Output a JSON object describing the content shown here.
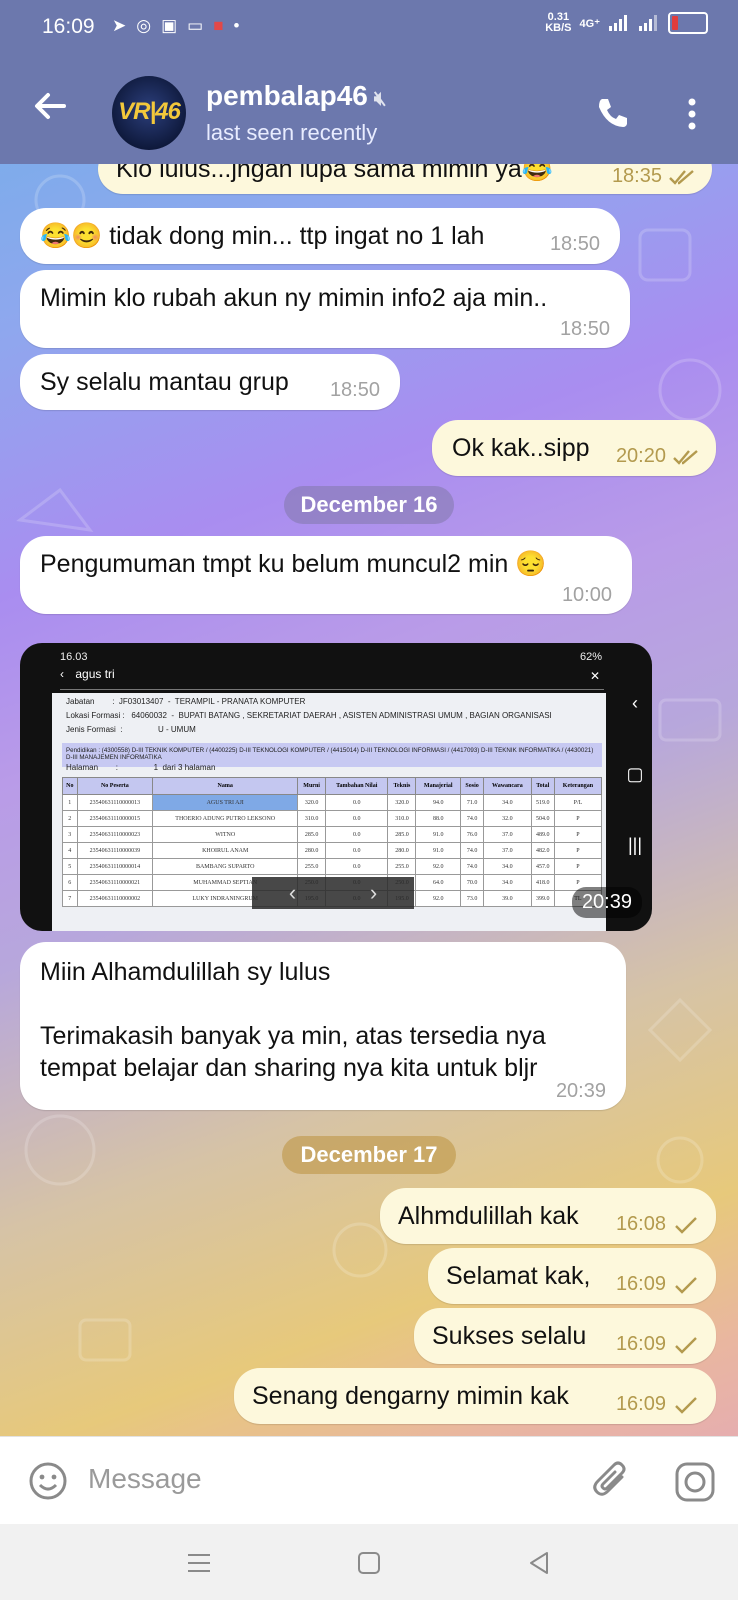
{
  "status_bar": {
    "time": "16:09",
    "speed_value": "0.31",
    "speed_unit": "KB/S",
    "network": "4G⁺"
  },
  "header": {
    "contact_name": "pembalap46",
    "avatar_text": "VR|46",
    "last_seen": "last seen recently"
  },
  "messages": [
    {
      "dir": "out",
      "text": "Klo lulus...jngan lupa sama mimin ya😂",
      "time": "18:35",
      "status": "read"
    },
    {
      "dir": "in",
      "text": "😂😊 tidak dong min... ttp ingat no 1 lah",
      "time": "18:50"
    },
    {
      "dir": "in",
      "text": "Mimin klo rubah akun ny mimin info2 aja min..",
      "time": "18:50"
    },
    {
      "dir": "in",
      "text": "Sy selalu mantau grup",
      "time": "18:50"
    },
    {
      "dir": "out",
      "text": "Ok kak..sipp",
      "time": "20:20",
      "status": "read"
    },
    {
      "dir": "in",
      "text": "Pengumuman tmpt ku belum muncul2 min 😔",
      "time": "10:00"
    },
    {
      "dir": "in",
      "text": "Miin Alhamdulillah sy lulus\n\nTerimakasih banyak ya min, atas tersedia nya\ntempat belajar dan sharing nya kita untuk bljr",
      "time": "20:39"
    },
    {
      "dir": "out",
      "text": "Alhmdulillah kak",
      "time": "16:08",
      "status": "sent"
    },
    {
      "dir": "out",
      "text": "Selamat kak,",
      "time": "16:09",
      "status": "sent"
    },
    {
      "dir": "out",
      "text": "Sukses selalu",
      "time": "16:09",
      "status": "sent"
    },
    {
      "dir": "out",
      "text": "Senang dengarny mimin kak",
      "time": "16:09",
      "status": "sent"
    }
  ],
  "date_separators": [
    "December 16",
    "December 17"
  ],
  "image_message": {
    "time": "20:39",
    "shot_time": "16.03",
    "shot_battery": "62%",
    "search_query": "agus tri",
    "jabatan": "Jabatan        :  JF03013407  -  TERAMPIL - PRANATA KOMPUTER",
    "lokasi": "Lokasi Formasi :   64060032  -  BUPATI BATANG , SEKRETARIAT DAERAH , ASISTEN ADMINISTRASI UMUM , BAGIAN ORGANISASI",
    "jenis": "Jenis Formasi  :                U - UMUM",
    "pendidikan": "Pendidikan     :  (4300558) D-III TEKNIK KOMPUTER / (4400225) D-III TEKNOLOGI KOMPUTER / (4415014) D-III TEKNOLOGI INFORMASI / (4417093) D-III TEKNIK INFORMATIKA / (4430021) D-III MANAJEMEN INFORMATIKA",
    "halaman": "Halaman        :                1  dari 3 halaman",
    "columns": [
      "No",
      "No Peserta",
      "Nama",
      "Murni",
      "Tambahan Nilai",
      "Teknis",
      "Manajerial",
      "Sosio",
      "Wawancara",
      "Total",
      "Keterangan"
    ],
    "rows": [
      [
        "1",
        "23540631110000013",
        "AGUS TRI AJI",
        "320.0",
        "0.0",
        "320.0",
        "94.0",
        "71.0",
        "34.0",
        "519.0",
        "P/L"
      ],
      [
        "2",
        "23540631110000015",
        "THOERIO ADUNG PUTRO LEKSONO",
        "310.0",
        "0.0",
        "310.0",
        "88.0",
        "74.0",
        "32.0",
        "504.0",
        "P"
      ],
      [
        "3",
        "23540631110000023",
        "WITNO",
        "285.0",
        "0.0",
        "285.0",
        "91.0",
        "76.0",
        "37.0",
        "489.0",
        "P"
      ],
      [
        "4",
        "23540631110000039",
        "KHOIRUL ANAM",
        "280.0",
        "0.0",
        "280.0",
        "91.0",
        "74.0",
        "37.0",
        "482.0",
        "P"
      ],
      [
        "5",
        "23540631110000014",
        "BAMBANG SUPARTO",
        "255.0",
        "0.0",
        "255.0",
        "92.0",
        "74.0",
        "34.0",
        "457.0",
        "P"
      ],
      [
        "6",
        "23540631110000021",
        "MUHAMMAD SEPTIAN",
        "250.0",
        "0.0",
        "250.0",
        "64.0",
        "70.0",
        "34.0",
        "418.0",
        "P"
      ],
      [
        "7",
        "23540631110000002",
        "LUKY INDRANINGRUM",
        "195.0",
        "0.0",
        "195.0",
        "92.0",
        "73.0",
        "39.0",
        "399.0",
        "TL"
      ]
    ]
  },
  "input": {
    "placeholder": "Message"
  }
}
